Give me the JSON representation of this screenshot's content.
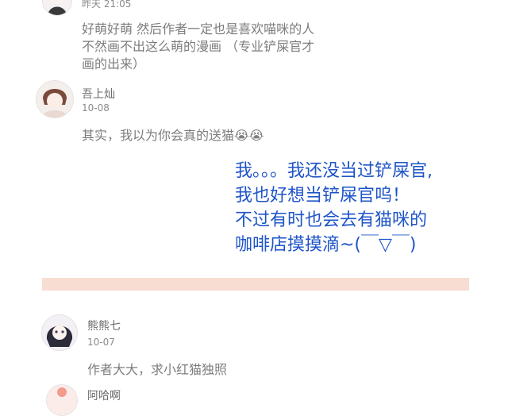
{
  "comments": [
    {
      "name": "",
      "time": "昨天 21:05",
      "lines": [
        "好萌好萌 然后作者一定也是喜欢喵咪的人",
        "不然画不出这么萌的漫画 （专业铲屎官才",
        "画的出来）"
      ]
    },
    {
      "name": "吾上灿",
      "time": "10-08",
      "lines": [
        "其实，我以为你会真的送猫😭😭"
      ]
    },
    {
      "name": "熊熊七",
      "time": "10-07",
      "lines": [
        "作者大大，求小红猫独照"
      ]
    },
    {
      "name": "阿哈啊",
      "time": "",
      "lines": []
    }
  ],
  "handwritten_reply": {
    "lines": [
      "我。。。我还没当过铲屎官,",
      "我也好想当铲屎官呜！",
      "不过有时也会去有猫咪的",
      "咖啡店摸摸滴~(￣▽￣)"
    ]
  },
  "colors": {
    "divider": "#f8ddd3",
    "reply_text": "#1e54c8"
  }
}
